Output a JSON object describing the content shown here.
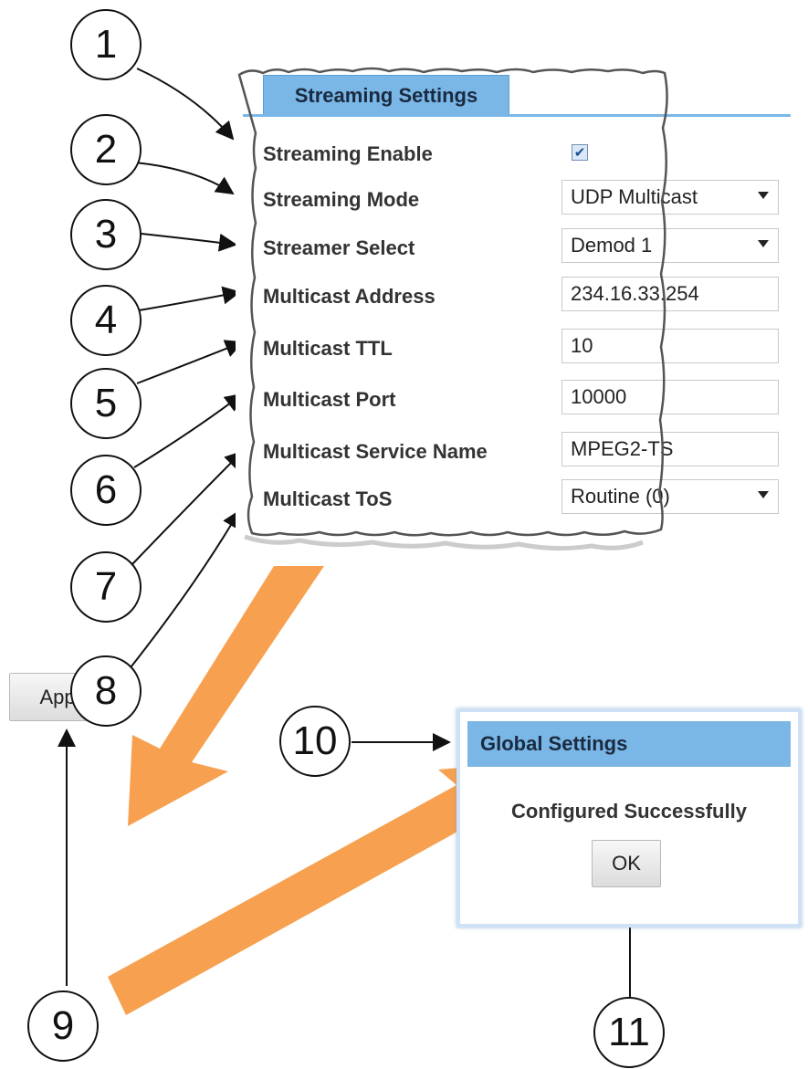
{
  "streaming": {
    "tab_label": "Streaming Settings",
    "enable_label": "Streaming Enable",
    "enable_checked": true,
    "mode_label": "Streaming Mode",
    "mode_value": "UDP Multicast",
    "streamer_label": "Streamer Select",
    "streamer_value": "Demod 1",
    "address_label": "Multicast Address",
    "address_value": "234.16.33.254",
    "ttl_label": "Multicast TTL",
    "ttl_value": "10",
    "port_label": "Multicast Port",
    "port_value": "10000",
    "service_label": "Multicast Service Name",
    "service_value": "MPEG2-TS",
    "tos_label": "Multicast ToS",
    "tos_value": "Routine (0)"
  },
  "apply_label": "Apply",
  "dialog": {
    "title": "Global Settings",
    "message": "Configured Successfully",
    "ok_label": "OK"
  },
  "callouts": [
    "1",
    "2",
    "3",
    "4",
    "5",
    "6",
    "7",
    "8",
    "9",
    "10",
    "11"
  ],
  "colors": {
    "accent": "#7ab7e6",
    "arrow": "#f7a04f"
  }
}
